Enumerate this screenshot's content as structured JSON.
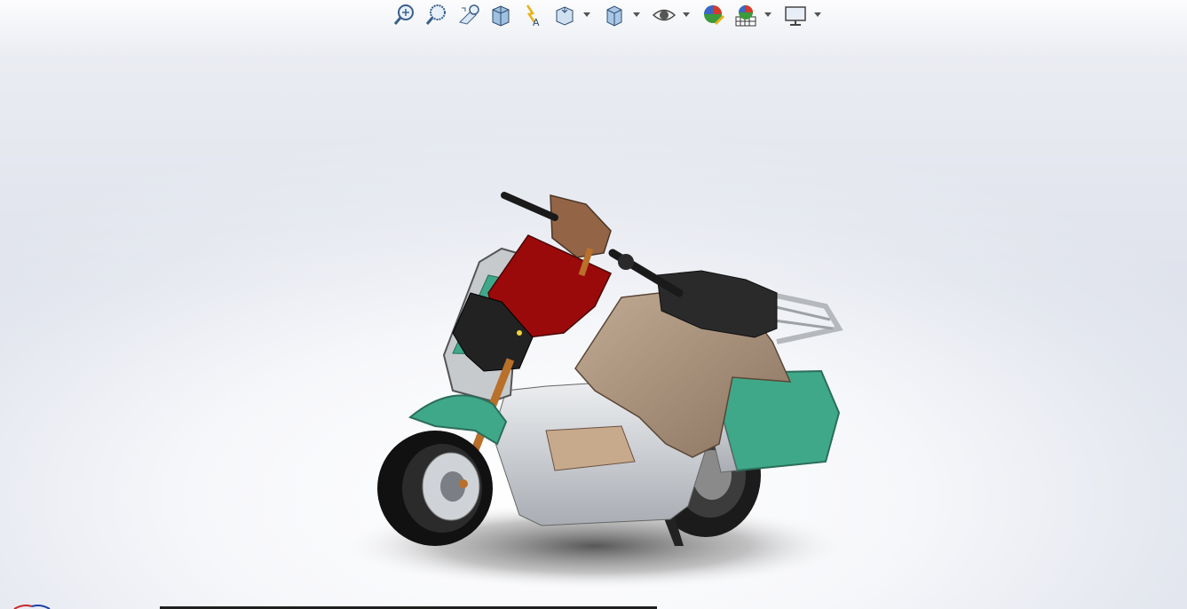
{
  "toolbar": {
    "buttons": [
      {
        "name": "zoom-to-fit-icon"
      },
      {
        "name": "zoom-to-area-icon"
      },
      {
        "name": "previous-view-icon"
      },
      {
        "name": "section-view-icon"
      },
      {
        "name": "dynamic-annotation-views-icon"
      },
      {
        "name": "view-orientation-icon",
        "dropdown": true
      },
      {
        "name": "display-style-icon",
        "dropdown": true
      },
      {
        "name": "hide-show-items-icon",
        "dropdown": true
      },
      {
        "name": "edit-appearance-icon"
      },
      {
        "name": "apply-scene-icon",
        "dropdown": true
      },
      {
        "name": "view-settings-icon",
        "dropdown": true
      }
    ]
  },
  "colors": {
    "body_green": "#3fa889",
    "fairing_red": "#9b0a0a",
    "seat_black": "#2a2a2a",
    "bag_tan": "#a08a74",
    "frame_silver": "#cfd2d6",
    "fork_orange": "#b8702a",
    "windshield_brown": "#8c5a38"
  }
}
